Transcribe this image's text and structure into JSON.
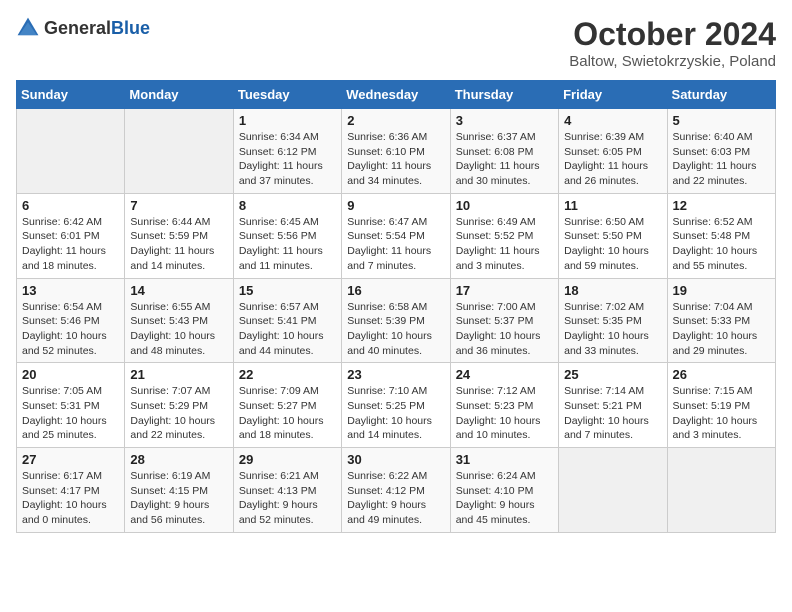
{
  "header": {
    "logo": {
      "general": "General",
      "blue": "Blue"
    },
    "month": "October 2024",
    "location": "Baltow, Swietokrzyskie, Poland"
  },
  "weekdays": [
    "Sunday",
    "Monday",
    "Tuesday",
    "Wednesday",
    "Thursday",
    "Friday",
    "Saturday"
  ],
  "weeks": [
    [
      {
        "day": null
      },
      {
        "day": null
      },
      {
        "day": "1",
        "sunrise": "Sunrise: 6:34 AM",
        "sunset": "Sunset: 6:12 PM",
        "daylight": "Daylight: 11 hours and 37 minutes."
      },
      {
        "day": "2",
        "sunrise": "Sunrise: 6:36 AM",
        "sunset": "Sunset: 6:10 PM",
        "daylight": "Daylight: 11 hours and 34 minutes."
      },
      {
        "day": "3",
        "sunrise": "Sunrise: 6:37 AM",
        "sunset": "Sunset: 6:08 PM",
        "daylight": "Daylight: 11 hours and 30 minutes."
      },
      {
        "day": "4",
        "sunrise": "Sunrise: 6:39 AM",
        "sunset": "Sunset: 6:05 PM",
        "daylight": "Daylight: 11 hours and 26 minutes."
      },
      {
        "day": "5",
        "sunrise": "Sunrise: 6:40 AM",
        "sunset": "Sunset: 6:03 PM",
        "daylight": "Daylight: 11 hours and 22 minutes."
      }
    ],
    [
      {
        "day": "6",
        "sunrise": "Sunrise: 6:42 AM",
        "sunset": "Sunset: 6:01 PM",
        "daylight": "Daylight: 11 hours and 18 minutes."
      },
      {
        "day": "7",
        "sunrise": "Sunrise: 6:44 AM",
        "sunset": "Sunset: 5:59 PM",
        "daylight": "Daylight: 11 hours and 14 minutes."
      },
      {
        "day": "8",
        "sunrise": "Sunrise: 6:45 AM",
        "sunset": "Sunset: 5:56 PM",
        "daylight": "Daylight: 11 hours and 11 minutes."
      },
      {
        "day": "9",
        "sunrise": "Sunrise: 6:47 AM",
        "sunset": "Sunset: 5:54 PM",
        "daylight": "Daylight: 11 hours and 7 minutes."
      },
      {
        "day": "10",
        "sunrise": "Sunrise: 6:49 AM",
        "sunset": "Sunset: 5:52 PM",
        "daylight": "Daylight: 11 hours and 3 minutes."
      },
      {
        "day": "11",
        "sunrise": "Sunrise: 6:50 AM",
        "sunset": "Sunset: 5:50 PM",
        "daylight": "Daylight: 10 hours and 59 minutes."
      },
      {
        "day": "12",
        "sunrise": "Sunrise: 6:52 AM",
        "sunset": "Sunset: 5:48 PM",
        "daylight": "Daylight: 10 hours and 55 minutes."
      }
    ],
    [
      {
        "day": "13",
        "sunrise": "Sunrise: 6:54 AM",
        "sunset": "Sunset: 5:46 PM",
        "daylight": "Daylight: 10 hours and 52 minutes."
      },
      {
        "day": "14",
        "sunrise": "Sunrise: 6:55 AM",
        "sunset": "Sunset: 5:43 PM",
        "daylight": "Daylight: 10 hours and 48 minutes."
      },
      {
        "day": "15",
        "sunrise": "Sunrise: 6:57 AM",
        "sunset": "Sunset: 5:41 PM",
        "daylight": "Daylight: 10 hours and 44 minutes."
      },
      {
        "day": "16",
        "sunrise": "Sunrise: 6:58 AM",
        "sunset": "Sunset: 5:39 PM",
        "daylight": "Daylight: 10 hours and 40 minutes."
      },
      {
        "day": "17",
        "sunrise": "Sunrise: 7:00 AM",
        "sunset": "Sunset: 5:37 PM",
        "daylight": "Daylight: 10 hours and 36 minutes."
      },
      {
        "day": "18",
        "sunrise": "Sunrise: 7:02 AM",
        "sunset": "Sunset: 5:35 PM",
        "daylight": "Daylight: 10 hours and 33 minutes."
      },
      {
        "day": "19",
        "sunrise": "Sunrise: 7:04 AM",
        "sunset": "Sunset: 5:33 PM",
        "daylight": "Daylight: 10 hours and 29 minutes."
      }
    ],
    [
      {
        "day": "20",
        "sunrise": "Sunrise: 7:05 AM",
        "sunset": "Sunset: 5:31 PM",
        "daylight": "Daylight: 10 hours and 25 minutes."
      },
      {
        "day": "21",
        "sunrise": "Sunrise: 7:07 AM",
        "sunset": "Sunset: 5:29 PM",
        "daylight": "Daylight: 10 hours and 22 minutes."
      },
      {
        "day": "22",
        "sunrise": "Sunrise: 7:09 AM",
        "sunset": "Sunset: 5:27 PM",
        "daylight": "Daylight: 10 hours and 18 minutes."
      },
      {
        "day": "23",
        "sunrise": "Sunrise: 7:10 AM",
        "sunset": "Sunset: 5:25 PM",
        "daylight": "Daylight: 10 hours and 14 minutes."
      },
      {
        "day": "24",
        "sunrise": "Sunrise: 7:12 AM",
        "sunset": "Sunset: 5:23 PM",
        "daylight": "Daylight: 10 hours and 10 minutes."
      },
      {
        "day": "25",
        "sunrise": "Sunrise: 7:14 AM",
        "sunset": "Sunset: 5:21 PM",
        "daylight": "Daylight: 10 hours and 7 minutes."
      },
      {
        "day": "26",
        "sunrise": "Sunrise: 7:15 AM",
        "sunset": "Sunset: 5:19 PM",
        "daylight": "Daylight: 10 hours and 3 minutes."
      }
    ],
    [
      {
        "day": "27",
        "sunrise": "Sunrise: 6:17 AM",
        "sunset": "Sunset: 4:17 PM",
        "daylight": "Daylight: 10 hours and 0 minutes."
      },
      {
        "day": "28",
        "sunrise": "Sunrise: 6:19 AM",
        "sunset": "Sunset: 4:15 PM",
        "daylight": "Daylight: 9 hours and 56 minutes."
      },
      {
        "day": "29",
        "sunrise": "Sunrise: 6:21 AM",
        "sunset": "Sunset: 4:13 PM",
        "daylight": "Daylight: 9 hours and 52 minutes."
      },
      {
        "day": "30",
        "sunrise": "Sunrise: 6:22 AM",
        "sunset": "Sunset: 4:12 PM",
        "daylight": "Daylight: 9 hours and 49 minutes."
      },
      {
        "day": "31",
        "sunrise": "Sunrise: 6:24 AM",
        "sunset": "Sunset: 4:10 PM",
        "daylight": "Daylight: 9 hours and 45 minutes."
      },
      {
        "day": null
      },
      {
        "day": null
      }
    ]
  ]
}
